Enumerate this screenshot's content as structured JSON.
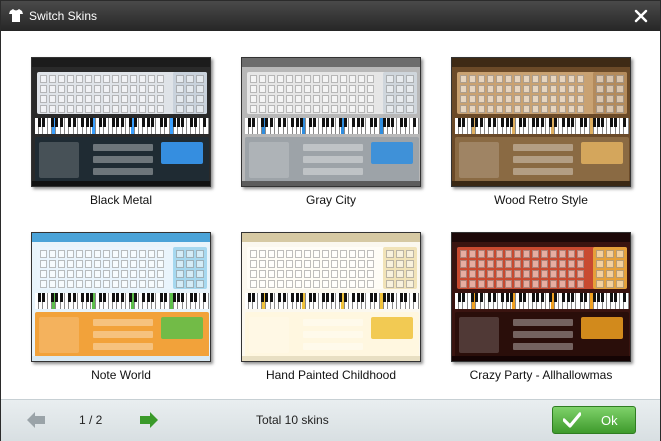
{
  "window": {
    "title": "Switch Skins"
  },
  "skins": [
    {
      "label": "Black Metal",
      "colors": {
        "frame": "#2a2a2a",
        "bar": "#1c1c1c",
        "kb": "#dfe3e8",
        "side": "#c9d2dc",
        "panel": "#1f2b33",
        "accent": "#3aa0ff",
        "status": "#111111"
      }
    },
    {
      "label": "Gray City",
      "colors": {
        "frame": "#b8b8b8",
        "bar": "#6c6c6c",
        "kb": "#e6e6e6",
        "side": "#cfd6dc",
        "panel": "#9da3a8",
        "accent": "#2f8ee0",
        "status": "#5c5c5c"
      }
    },
    {
      "label": "Wood Retro Style",
      "colors": {
        "frame": "#6b4a28",
        "bar": "#3e2a15",
        "kb": "#c9a272",
        "side": "#b48b5c",
        "panel": "#8a6a43",
        "accent": "#e0b060",
        "status": "#3a2814"
      }
    },
    {
      "label": "Note World",
      "colors": {
        "frame": "#e8f4fb",
        "bar": "#4aa3d8",
        "kb": "#eaf5fd",
        "side": "#a6d8ef",
        "panel": "#f2a23a",
        "accent": "#5cbf4a",
        "status": "#d9e9f2"
      }
    },
    {
      "label": "Hand Painted Childhood",
      "colors": {
        "frame": "#fbf8ef",
        "bar": "#d6c9a3",
        "kb": "#fffdf6",
        "side": "#f1e3b8",
        "panel": "#fff7e0",
        "accent": "#f0c23a",
        "status": "#e8dfc3"
      }
    },
    {
      "label": "Crazy Party - Allhallowmas",
      "colors": {
        "frame": "#3a1410",
        "bar": "#1c0808",
        "kb": "#c84a30",
        "side": "#e6a13a",
        "panel": "#2a0e0a",
        "accent": "#f0a020",
        "status": "#140404"
      }
    }
  ],
  "footer": {
    "page_indicator": "1 / 2",
    "total_text": "Total 10 skins",
    "ok_label": "Ok"
  }
}
